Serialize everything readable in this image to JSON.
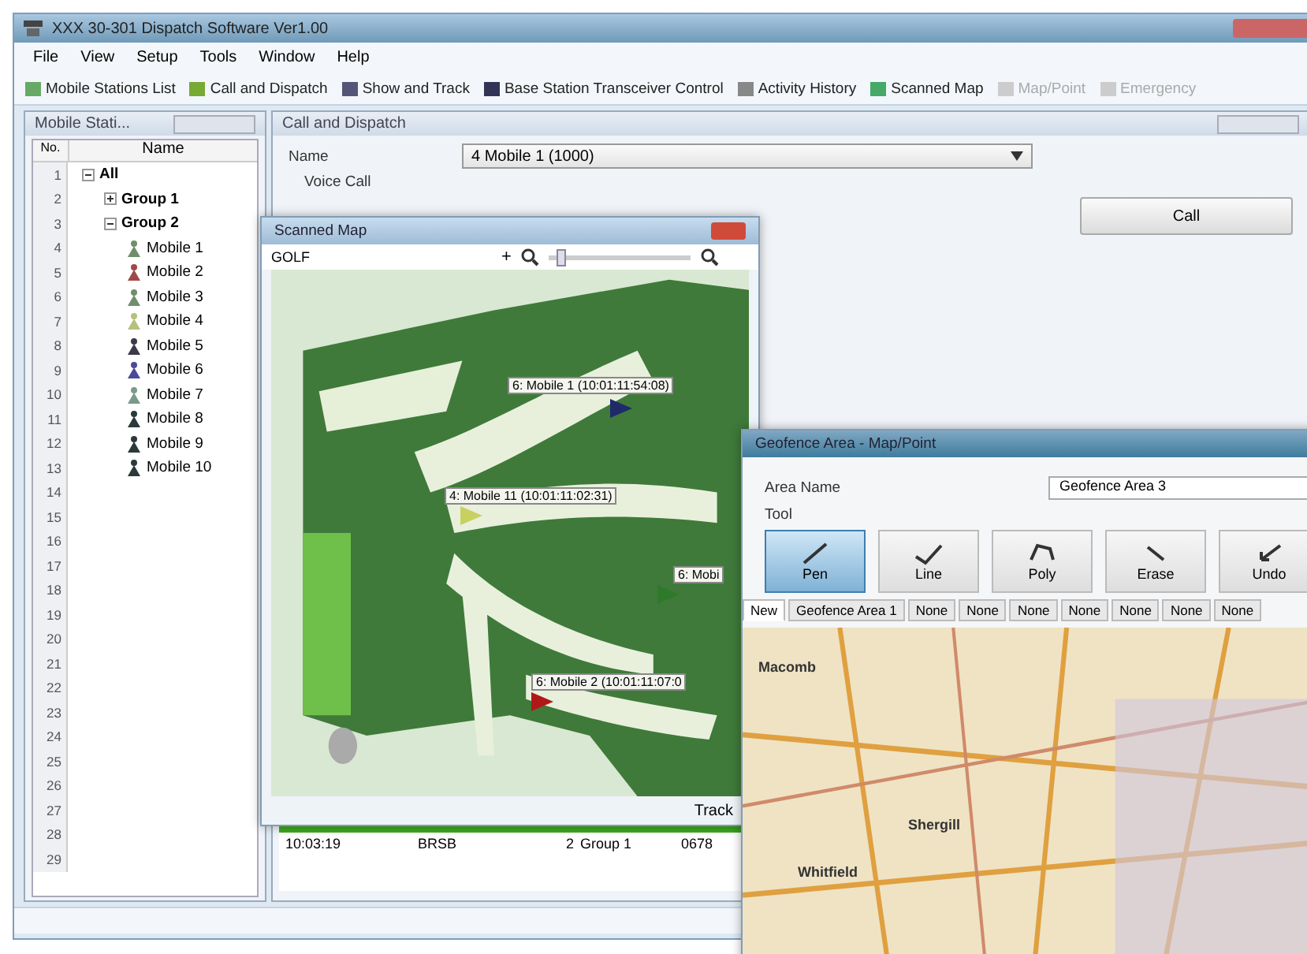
{
  "window": {
    "title": "XXX 30-301 Dispatch Software Ver1.00"
  },
  "menu": [
    "File",
    "View",
    "Setup",
    "Tools",
    "Window",
    "Help"
  ],
  "toolbar": [
    {
      "label": "Mobile Stations List",
      "disabled": false
    },
    {
      "label": "Call and Dispatch",
      "disabled": false
    },
    {
      "label": "Show and Track",
      "disabled": false
    },
    {
      "label": "Base Station Transceiver Control",
      "disabled": false
    },
    {
      "label": "Activity History",
      "disabled": false
    },
    {
      "label": "Scanned Map",
      "disabled": false
    },
    {
      "label": "Map/Point",
      "disabled": true
    },
    {
      "label": "Emergency",
      "disabled": true
    }
  ],
  "stations_panel": {
    "title": "Mobile Stati...",
    "columns": [
      "No.",
      "Name"
    ],
    "row_numbers": [
      "1",
      "2",
      "3",
      "4",
      "5",
      "6",
      "7",
      "8",
      "9",
      "10",
      "11",
      "12",
      "13",
      "14",
      "15",
      "16",
      "17",
      "18",
      "19",
      "20",
      "21",
      "22",
      "23",
      "24",
      "25",
      "26",
      "27",
      "28",
      "29"
    ],
    "tree": [
      {
        "label": "All",
        "expanded": true,
        "children": [
          {
            "label": "Group 1",
            "expanded": false
          },
          {
            "label": "Group 2",
            "expanded": true,
            "children": [
              {
                "label": "Mobile 1",
                "color": "#6f8f6a"
              },
              {
                "label": "Mobile 2",
                "color": "#a04848"
              },
              {
                "label": "Mobile 3",
                "color": "#6f8f6a"
              },
              {
                "label": "Mobile 4",
                "color": "#b4c27a"
              },
              {
                "label": "Mobile 5",
                "color": "#3a3a4a"
              },
              {
                "label": "Mobile 6",
                "color": "#4a4a9a"
              },
              {
                "label": "Mobile 7",
                "color": "#7a9a8a"
              },
              {
                "label": "Mobile 8",
                "color": "#2a3a3a"
              },
              {
                "label": "Mobile 9",
                "color": "#2a3a3a"
              },
              {
                "label": "Mobile 10",
                "color": "#2a3a3a"
              }
            ]
          }
        ]
      }
    ]
  },
  "call_panel": {
    "title": "Call and Dispatch",
    "name_label": "Name",
    "name_value": "4 Mobile 1 (1000)",
    "voice_call_label": "Voice Call",
    "call_button": "Call",
    "log_rows": [
      {
        "time": "10:03:19",
        "source": "BRSB",
        "number": "2",
        "target": "Group 1",
        "extra": "0678"
      }
    ]
  },
  "scanned_map": {
    "title": "Scanned Map",
    "map_selector": "GOLF",
    "plus": "+",
    "footer": "Track",
    "zoom": {
      "level": 0.08
    },
    "markers": [
      {
        "label": "6: Mobile 1 (10:01:11:54:08)",
        "color": "#1e2a6a"
      },
      {
        "label": "4: Mobile 11 (10:01:11:02:31)",
        "color": "#c8d060"
      },
      {
        "label": "6: Mobi",
        "color": "#2f7a2a"
      },
      {
        "label": "6: Mobile 2 (10:01:11:07:0",
        "color": "#b01818"
      }
    ]
  },
  "geofence": {
    "title": "Geofence Area - Map/Point",
    "area_name_label": "Area Name",
    "area_name_value": "Geofence Area 3",
    "tool_label": "Tool",
    "tools": [
      {
        "label": "Pen",
        "selected": true
      },
      {
        "label": "Line",
        "selected": false
      },
      {
        "label": "Poly",
        "selected": false
      },
      {
        "label": "Erase",
        "selected": false
      },
      {
        "label": "Undo",
        "selected": false
      }
    ],
    "tabs": [
      {
        "label": "New",
        "selected": true
      },
      {
        "label": "Geofence Area 1",
        "selected": false
      },
      {
        "label": "None",
        "selected": false
      },
      {
        "label": "None",
        "selected": false
      },
      {
        "label": "None",
        "selected": false
      },
      {
        "label": "None",
        "selected": false
      },
      {
        "label": "None",
        "selected": false
      },
      {
        "label": "None",
        "selected": false
      },
      {
        "label": "None",
        "selected": false
      }
    ],
    "map_labels": [
      "Macomb",
      "Shergill",
      "Whitfield"
    ]
  }
}
